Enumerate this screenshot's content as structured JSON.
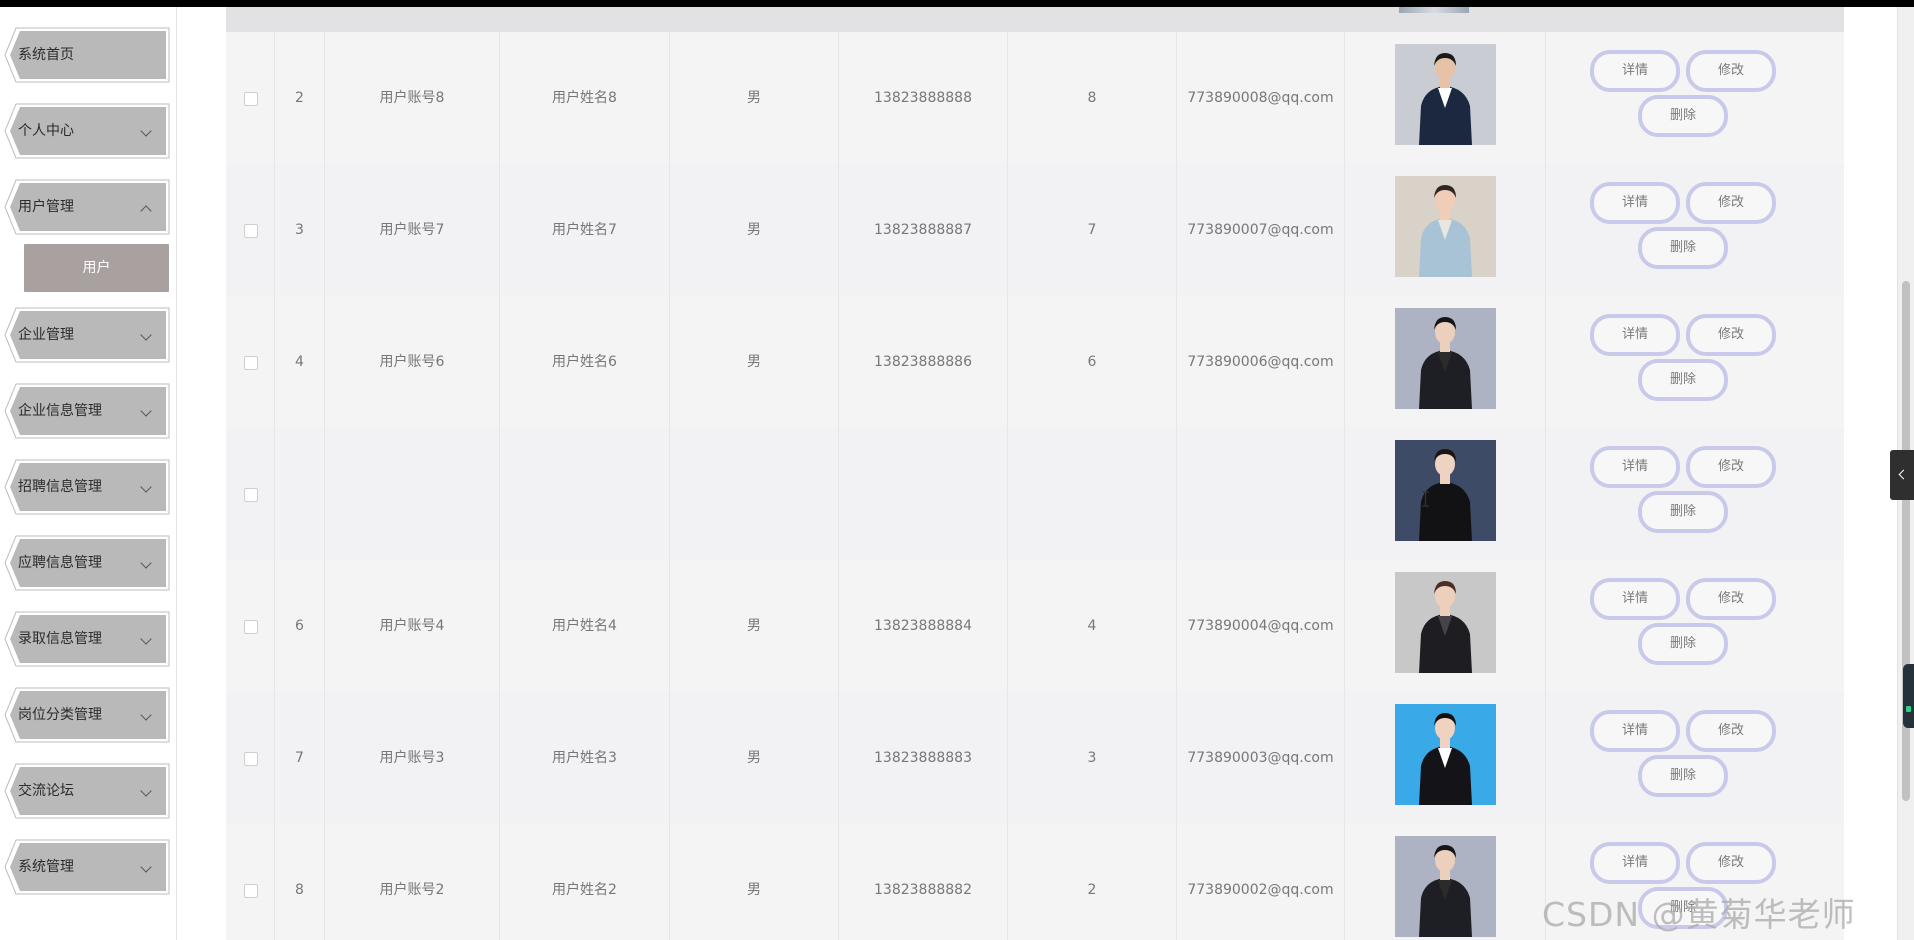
{
  "sidebar": {
    "items": [
      {
        "label": "系统首页",
        "chevron": "none"
      },
      {
        "label": "个人中心",
        "chevron": "down"
      },
      {
        "label": "用户管理",
        "chevron": "up"
      },
      {
        "label": "企业管理",
        "chevron": "down"
      },
      {
        "label": "企业信息管理",
        "chevron": "down"
      },
      {
        "label": "招聘信息管理",
        "chevron": "down"
      },
      {
        "label": "应聘信息管理",
        "chevron": "down"
      },
      {
        "label": "录取信息管理",
        "chevron": "down"
      },
      {
        "label": "岗位分类管理",
        "chevron": "down"
      },
      {
        "label": "交流论坛",
        "chevron": "down"
      },
      {
        "label": "系统管理",
        "chevron": "down"
      }
    ],
    "submenu": {
      "label": "用户"
    }
  },
  "buttons": {
    "detail": "详情",
    "edit": "修改",
    "delete": "删除"
  },
  "rows": [
    {
      "index": "2",
      "account": "用户账号8",
      "name": "用户姓名8",
      "gender": "男",
      "phone": "13823888888",
      "num": "8",
      "email": "773890008@qq.com",
      "photo": {
        "bg": "#c9ccd2",
        "suit": "#1c2740",
        "shirt": "#ffffff",
        "skin": "#e7c2a6",
        "hair": "#1a1a1a"
      }
    },
    {
      "index": "3",
      "account": "用户账号7",
      "name": "用户姓名7",
      "gender": "男",
      "phone": "13823888887",
      "num": "7",
      "email": "773890007@qq.com",
      "photo": {
        "bg": "#d8d2c8",
        "suit": "#a9c3d6",
        "shirt": "#e9e6e0",
        "skin": "#f0cdb6",
        "hair": "#2e2622"
      }
    },
    {
      "index": "4",
      "account": "用户账号6",
      "name": "用户姓名6",
      "gender": "男",
      "phone": "13823888886",
      "num": "6",
      "email": "773890006@qq.com",
      "photo": {
        "bg": "#aeb3c4",
        "suit": "#1e1f24",
        "shirt": "#2b2b2b",
        "skin": "#ecd0bd",
        "hair": "#151515"
      }
    },
    {
      "index": "",
      "account": "",
      "name": "",
      "gender": "",
      "phone": "",
      "num": "",
      "email": "",
      "photo": {
        "bg": "#3e4b66",
        "suit": "#121214",
        "shirt": "#121214",
        "skin": "#efd3c2",
        "hair": "#1b1411"
      }
    },
    {
      "index": "6",
      "account": "用户账号4",
      "name": "用户姓名4",
      "gender": "男",
      "phone": "13823888884",
      "num": "4",
      "email": "773890004@qq.com",
      "photo": {
        "bg": "#c8c8c8",
        "suit": "#1e1e22",
        "shirt": "#47434a",
        "skin": "#edd0bc",
        "hair": "#4b2f22"
      }
    },
    {
      "index": "7",
      "account": "用户账号3",
      "name": "用户姓名3",
      "gender": "男",
      "phone": "13823888883",
      "num": "3",
      "email": "773890003@qq.com",
      "photo": {
        "bg": "#3aa9e8",
        "suit": "#141418",
        "shirt": "#ffffff",
        "skin": "#efd2bf",
        "hair": "#141010"
      }
    },
    {
      "index": "8",
      "account": "用户账号2",
      "name": "用户姓名2",
      "gender": "男",
      "phone": "13823888882",
      "num": "2",
      "email": "773890002@qq.com",
      "photo": {
        "bg": "#aeb3c4",
        "suit": "#1e1f24",
        "shirt": "#2b2b2b",
        "skin": "#ecd0bd",
        "hair": "#151515"
      }
    }
  ],
  "watermark": "CSDN @黄菊华老师"
}
